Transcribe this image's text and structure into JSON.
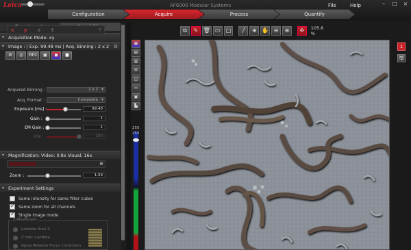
{
  "app": {
    "name": "AF6000 Modular Systems",
    "menu": [
      "File",
      "Help"
    ],
    "window_controls": {
      "minimize": "–",
      "maximize": "□",
      "close": "×"
    }
  },
  "workflow_tabs": [
    {
      "label": "Configuration",
      "active": false
    },
    {
      "label": "Acquire",
      "active": true
    },
    {
      "label": "Process",
      "active": false
    },
    {
      "label": "Quantify",
      "active": false
    }
  ],
  "left_panel": {
    "tabs": [
      {
        "label": "Experiments",
        "active": false
      },
      {
        "label": "Acquisition",
        "active": true
      }
    ],
    "acq_mode_header": "Acquisition Mode: xy",
    "xyzt": {
      "x": "x",
      "y": "y",
      "z": "z",
      "t": "t"
    },
    "image_header": "Image : | Exp. 99.48 ms | Acq. Binning : 2 x 2",
    "image_buttons": [
      "RFC"
    ],
    "acquired_binning": {
      "label": "Acquired Binning :",
      "value": "2 x 2"
    },
    "acq_format": {
      "label": "Acq. Format :",
      "value": "Composite"
    },
    "exposure": {
      "label": "Exposure [ms] :",
      "value": "99.48",
      "level": 0.62
    },
    "gain": {
      "label": "Gain :",
      "value": "1",
      "level": 0.0
    },
    "em_gain": {
      "label": "EM Gain :",
      "value": "1",
      "level": 0.0
    },
    "iris": {
      "label": "Iris :",
      "value": "100",
      "level": 1.0
    },
    "magnification_header": "Magnification:   Video: 0.8x    Visual: 16x",
    "zoom": {
      "label": "Zoom :",
      "value": "1.59",
      "level": 0.45
    },
    "experiment_settings_header": "Experiment Settings",
    "checkboxes": [
      {
        "label": "Same intensity for same filter cubes",
        "checked": false
      },
      {
        "label": "Same zoom for all channels",
        "checked": true
      },
      {
        "label": "Single image mode",
        "checked": true
      }
    ],
    "z_movement": {
      "title": "Z-Movement",
      "options": [
        "Lambda then Z",
        "Z then Lambda",
        "Apply Relative Focus Correction"
      ]
    }
  },
  "toolbar": {
    "icons": [
      "copy-icon",
      "pen-icon",
      "trash-icon",
      "rect-icon",
      "frame-icon",
      "line-icon",
      "crosshair-icon",
      "hand-icon",
      "zoom-out-icon",
      "zoom-in-icon",
      "fit-icon"
    ],
    "zoom_level": "105.6 %"
  },
  "lut": {
    "top_label": "255",
    "mid_label": "255"
  },
  "right_panel": {
    "badge": "1"
  }
}
